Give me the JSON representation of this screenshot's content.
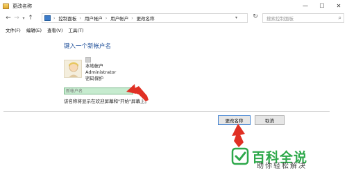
{
  "window": {
    "title": "更改名称",
    "controls": {
      "minimize": "—",
      "maximize": "☐",
      "close": "✕"
    }
  },
  "nav": {
    "back_icon": "←",
    "forward_icon": "→",
    "up_icon": "↑",
    "breadcrumb": [
      "控制面板",
      "用户帐户",
      "用户帐户",
      "更改名称"
    ],
    "refresh_icon": "↻",
    "search_placeholder": "搜索控制面板"
  },
  "menu": [
    "文件(F)",
    "编辑(E)",
    "查看(V)",
    "工具(T)"
  ],
  "main": {
    "heading": "键入一个新帐户名",
    "account_type": "本地帐户",
    "username": "Administrator",
    "password_status": "密码保护",
    "new_name_placeholder": "新帐户名",
    "hint": "该名称将显示在欢迎屏幕和\"开始\"屏幕上。"
  },
  "buttons": {
    "confirm": "更改名称",
    "cancel": "取消"
  },
  "watermark": {
    "main": "百科全说",
    "sub": "助你轻松解决"
  },
  "colors": {
    "heading": "#1f4f99",
    "input_fill": "#c6ebcf",
    "annotation_red": "#e03024",
    "watermark_green": "#2da84a"
  }
}
